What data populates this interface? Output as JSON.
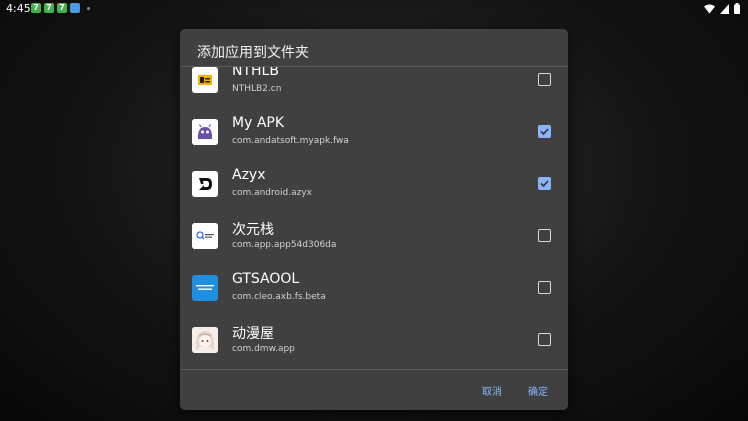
{
  "status_bar": {
    "time": "4:45",
    "notifications": [
      {
        "icon": "app-7-icon",
        "glyph": "7"
      },
      {
        "icon": "app-7-icon",
        "glyph": "7"
      },
      {
        "icon": "app-7-icon",
        "glyph": "7"
      },
      {
        "icon": "app-blue-icon",
        "glyph": ""
      }
    ]
  },
  "dialog": {
    "title": "添加应用到文件夹",
    "cancel_label": "取消",
    "ok_label": "确定"
  },
  "apps": [
    {
      "name": "NTHLB",
      "package": "NTHLB2.cn",
      "checked": false,
      "icon": "nthlb-app-icon"
    },
    {
      "name": "My APK",
      "package": "com.andatsoft.myapk.fwa",
      "checked": true,
      "icon": "myapk-app-icon"
    },
    {
      "name": "Azyx",
      "package": "com.android.azyx",
      "checked": true,
      "icon": "azyx-app-icon"
    },
    {
      "name": "次元栈",
      "package": "com.app.app54d306da",
      "checked": false,
      "icon": "ciyuanzhan-app-icon"
    },
    {
      "name": "GTSAOOL",
      "package": "com.cleo.axb.fs.beta",
      "checked": false,
      "icon": "gtsaool-app-icon"
    },
    {
      "name": "动漫屋",
      "package": "com.dmw.app",
      "checked": false,
      "icon": "dongmanwu-app-icon"
    }
  ],
  "colors": {
    "accent": "#8ab4f8",
    "dialog_bg": "#404040",
    "notif_green": "#3db34a"
  }
}
